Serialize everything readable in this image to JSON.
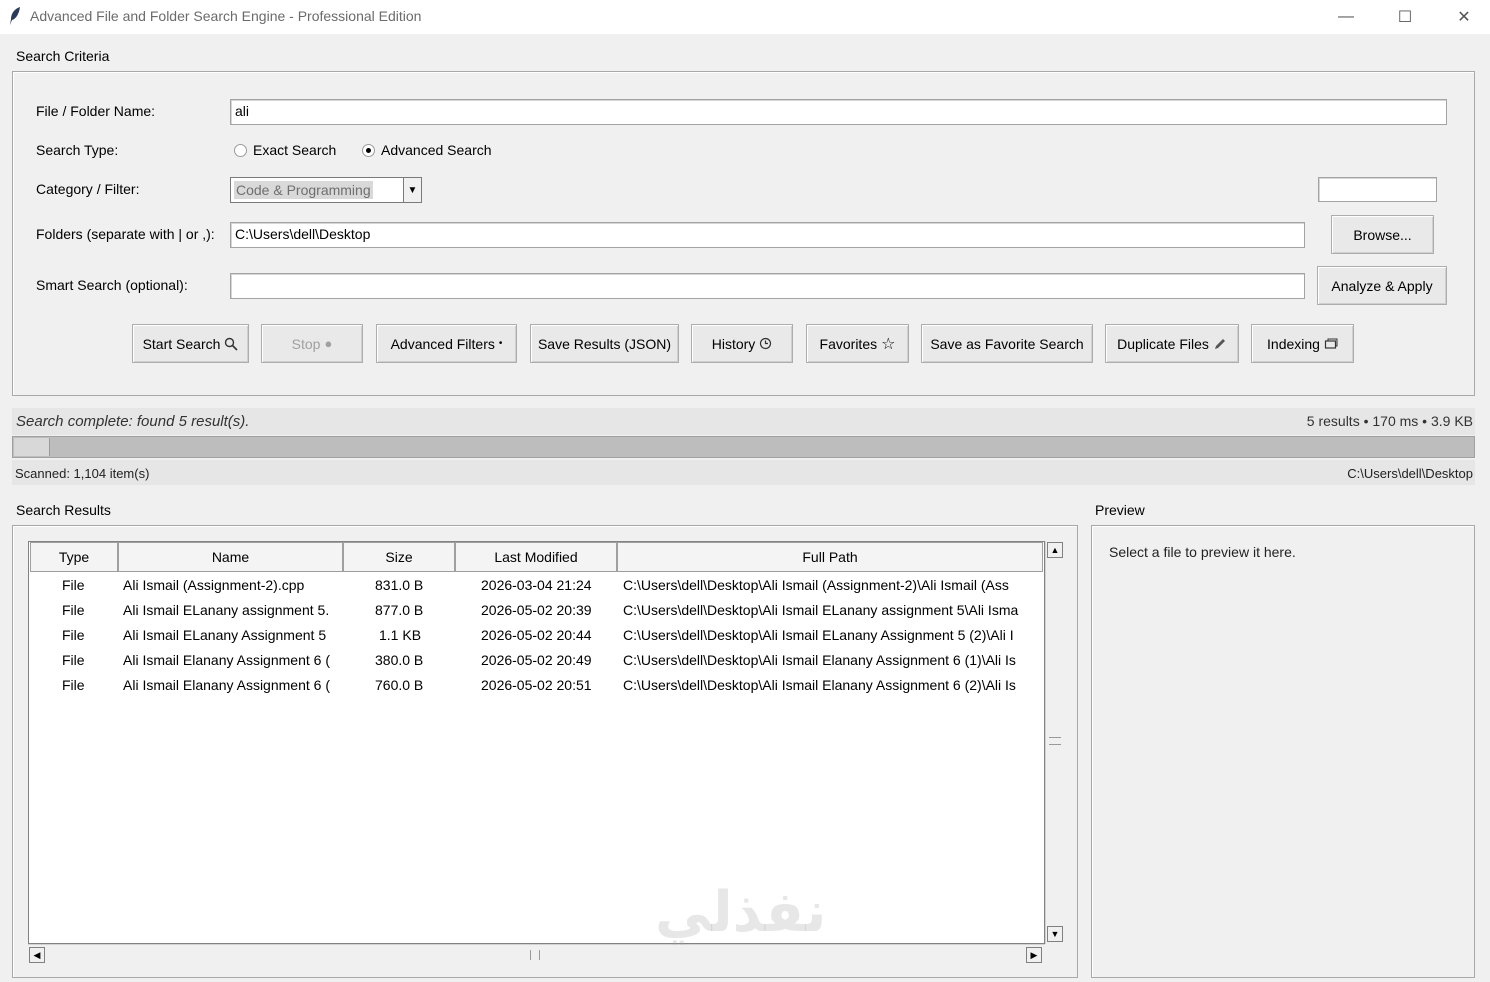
{
  "window": {
    "title": "Advanced File and Folder Search Engine - Professional Edition",
    "minimize_glyph": "—",
    "maximize_glyph": "☐",
    "close_glyph": "✕"
  },
  "criteria": {
    "section_label": "Search Criteria",
    "name_label": "File / Folder Name:",
    "name_value": "ali",
    "search_type_label": "Search Type:",
    "exact_label": "Exact Search",
    "advanced_label": "Advanced Search",
    "selected_type": "Advanced Search",
    "category_label": "Category / Filter:",
    "category_value": "Code & Programming",
    "category_extra_value": "",
    "folders_label": "Folders (separate with | or ,):",
    "folders_value": "C:\\Users\\dell\\Desktop",
    "browse_label": "Browse...",
    "smart_label": "Smart Search (optional):",
    "smart_value": "",
    "analyze_label": "Analyze & Apply"
  },
  "toolbar": {
    "start": "Start Search",
    "stop": "Stop",
    "advanced_filters": "Advanced Filters",
    "save_json": "Save Results (JSON)",
    "history": "History",
    "favorites": "Favorites",
    "save_favorite": "Save as Favorite Search",
    "duplicates": "Duplicate Files",
    "indexing": "Indexing"
  },
  "status": {
    "message": "Search complete: found 5 result(s).",
    "stats": "5 results  •  170 ms  •  3.9 KB",
    "progress_fraction": 0.025,
    "scanned": "Scanned: 1,104 item(s)",
    "current_path": "C:\\Users\\dell\\Desktop"
  },
  "results": {
    "section_label": "Search Results",
    "columns": [
      "Type",
      "Name",
      "Size",
      "Last Modified",
      "Full Path"
    ],
    "rows": [
      {
        "type": "File",
        "name": "Ali Ismail (Assignment-2).cpp",
        "size": "831.0 B",
        "modified": "2026-03-04 21:24",
        "path": "C:\\Users\\dell\\Desktop\\Ali Ismail (Assignment-2)\\Ali Ismail (Ass"
      },
      {
        "type": "File",
        "name": "Ali Ismail ELanany assignment 5.",
        "size": "877.0 B",
        "modified": "2026-05-02 20:39",
        "path": "C:\\Users\\dell\\Desktop\\Ali Ismail ELanany assignment 5\\Ali Isma"
      },
      {
        "type": "File",
        "name": "Ali Ismail ELanany Assignment 5",
        "size": "1.1 KB",
        "modified": "2026-05-02 20:44",
        "path": "C:\\Users\\dell\\Desktop\\Ali Ismail ELanany Assignment 5 (2)\\Ali I"
      },
      {
        "type": "File",
        "name": "Ali Ismail Elanany Assignment 6 (",
        "size": "380.0 B",
        "modified": "2026-05-02 20:49",
        "path": "C:\\Users\\dell\\Desktop\\Ali Ismail Elanany Assignment 6 (1)\\Ali Is"
      },
      {
        "type": "File",
        "name": "Ali Ismail Elanany Assignment 6 (",
        "size": "760.0 B",
        "modified": "2026-05-02 20:51",
        "path": "C:\\Users\\dell\\Desktop\\Ali Ismail Elanany Assignment 6 (2)\\Ali Is"
      }
    ]
  },
  "preview": {
    "section_label": "Preview",
    "placeholder": "Select a file to preview it here."
  },
  "watermark": "نفذلي"
}
